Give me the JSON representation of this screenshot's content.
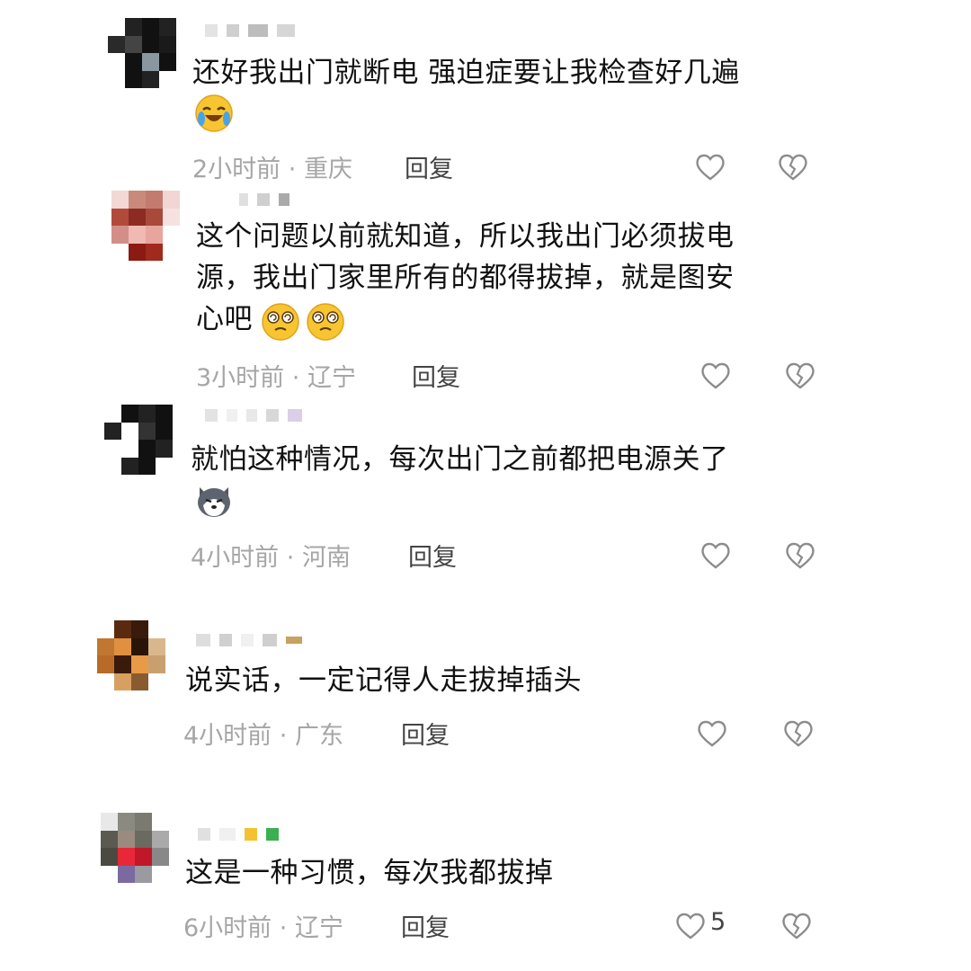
{
  "comments": [
    {
      "text": "还好我出门就断电 强迫症要让我检查好几遍",
      "emoji": [
        "laughing-crying"
      ],
      "time": "2小时前",
      "location": "重庆",
      "reply": "回复"
    },
    {
      "text": "这个问题以前就知道，所以我出门必须拔电\n源，我出门家里所有的都得拔掉，就是图安\n心吧",
      "emoji": [
        "dizzy-face",
        "dizzy-face"
      ],
      "time": "3小时前",
      "location": "辽宁",
      "reply": "回复"
    },
    {
      "text": "就怕这种情况，每次出门之前都把电源关了",
      "emoji": [
        "husky-face"
      ],
      "time": "4小时前",
      "location": "河南",
      "reply": "回复"
    },
    {
      "text": "说实话，一定记得人走拔掉插头",
      "emoji": [],
      "time": "4小时前",
      "location": "广东",
      "reply": "回复"
    },
    {
      "text": "这是一种习惯，每次我都拔掉",
      "emoji": [],
      "time": "6小时前",
      "location": "辽宁",
      "reply": "回复",
      "like_count": "5"
    }
  ],
  "meta_separator": "·",
  "icons": {
    "like": "heart-outline-icon",
    "dislike": "broken-heart-icon"
  },
  "colors": {
    "meta": "#a6a6a6",
    "text": "#111111",
    "icon": "#8c8c8c"
  }
}
